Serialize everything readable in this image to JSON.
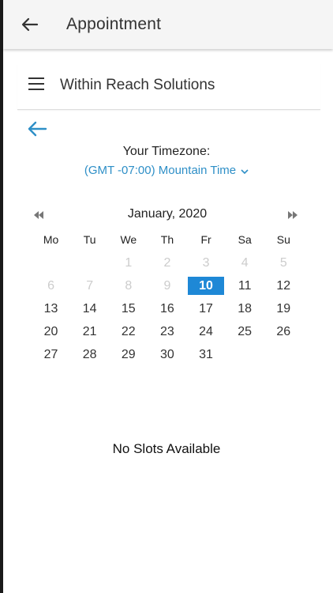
{
  "app_bar": {
    "title": "Appointment",
    "back_icon": "arrow-left-icon"
  },
  "site_header": {
    "name": "Within Reach Solutions",
    "menu_icon": "hamburger-menu-icon"
  },
  "content": {
    "back_icon": "arrow-left-icon",
    "accent_color": "#2e8fc7"
  },
  "timezone": {
    "label": "Your Timezone:",
    "value": "(GMT -07:00) Mountain Time",
    "chevron_icon": "chevron-down-icon"
  },
  "calendar": {
    "month_label": "January, 2020",
    "prev_icon": "double-chevron-left-icon",
    "next_icon": "double-chevron-right-icon",
    "weekdays": [
      "Mo",
      "Tu",
      "We",
      "Th",
      "Fr",
      "Sa",
      "Su"
    ],
    "selected_color": "#1e88d6",
    "weeks": [
      [
        {
          "d": "",
          "disabled": true
        },
        {
          "d": "",
          "disabled": true
        },
        {
          "d": "1",
          "disabled": true
        },
        {
          "d": "2",
          "disabled": true
        },
        {
          "d": "3",
          "disabled": true
        },
        {
          "d": "4",
          "disabled": true
        },
        {
          "d": "5",
          "disabled": true
        }
      ],
      [
        {
          "d": "6",
          "disabled": true
        },
        {
          "d": "7",
          "disabled": true
        },
        {
          "d": "8",
          "disabled": true
        },
        {
          "d": "9",
          "disabled": true
        },
        {
          "d": "10",
          "selected": true
        },
        {
          "d": "11"
        },
        {
          "d": "12"
        }
      ],
      [
        {
          "d": "13"
        },
        {
          "d": "14"
        },
        {
          "d": "15"
        },
        {
          "d": "16"
        },
        {
          "d": "17"
        },
        {
          "d": "18"
        },
        {
          "d": "19"
        }
      ],
      [
        {
          "d": "20"
        },
        {
          "d": "21"
        },
        {
          "d": "22"
        },
        {
          "d": "23"
        },
        {
          "d": "24"
        },
        {
          "d": "25"
        },
        {
          "d": "26"
        }
      ],
      [
        {
          "d": "27"
        },
        {
          "d": "28"
        },
        {
          "d": "29"
        },
        {
          "d": "30"
        },
        {
          "d": "31"
        },
        {
          "d": ""
        },
        {
          "d": ""
        }
      ]
    ]
  },
  "slots": {
    "message": "No Slots Available"
  }
}
